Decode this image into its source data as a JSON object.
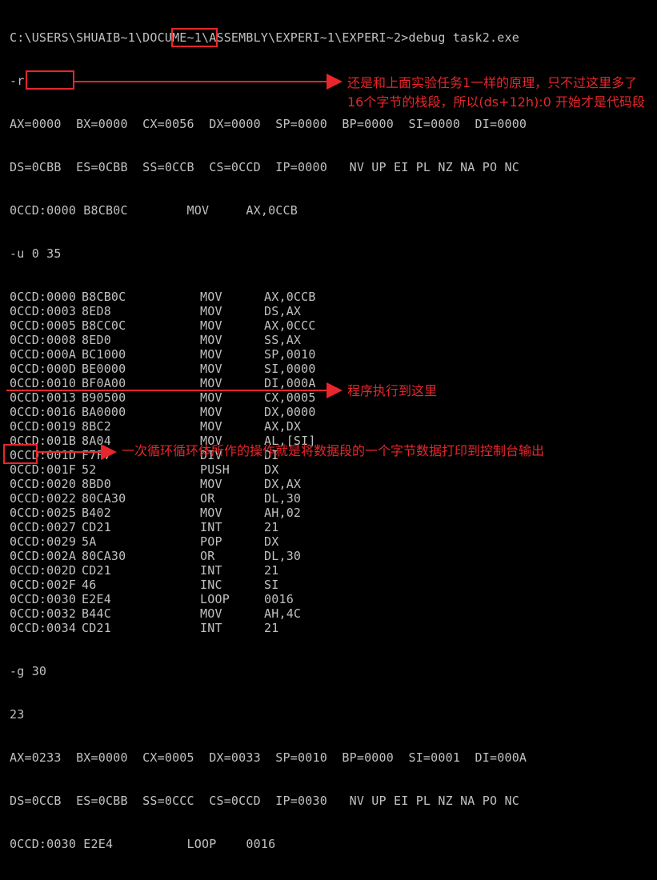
{
  "console": {
    "lines": [
      "C:\\USERS\\SHUAIB~1\\DOCUME~1\\ASSEMBLY\\EXPERI~1\\EXPERI~2>debug task2.exe",
      "-r",
      "AX=0000  BX=0000  CX=0056  DX=0000  SP=0000  BP=0000  SI=0000  DI=0000",
      "DS=0CBB  ES=0CBB  SS=0CCB  CS=0CCD  IP=0000   NV UP EI PL NZ NA PO NC",
      "0CCD:0000 B8CB0C        MOV     AX,0CCB",
      "-u 0 35"
    ],
    "disassembly": [
      {
        "addr": "0CCD:0000",
        "hex": "B8CB0C",
        "mnemonic": "MOV",
        "operands": "AX,0CCB"
      },
      {
        "addr": "0CCD:0003",
        "hex": "8ED8",
        "mnemonic": "MOV",
        "operands": "DS,AX"
      },
      {
        "addr": "0CCD:0005",
        "hex": "B8CC0C",
        "mnemonic": "MOV",
        "operands": "AX,0CCC"
      },
      {
        "addr": "0CCD:0008",
        "hex": "8ED0",
        "mnemonic": "MOV",
        "operands": "SS,AX"
      },
      {
        "addr": "0CCD:000A",
        "hex": "BC1000",
        "mnemonic": "MOV",
        "operands": "SP,0010"
      },
      {
        "addr": "0CCD:000D",
        "hex": "BE0000",
        "mnemonic": "MOV",
        "operands": "SI,0000"
      },
      {
        "addr": "0CCD:0010",
        "hex": "BF0A00",
        "mnemonic": "MOV",
        "operands": "DI,000A"
      },
      {
        "addr": "0CCD:0013",
        "hex": "B90500",
        "mnemonic": "MOV",
        "operands": "CX,0005"
      },
      {
        "addr": "0CCD:0016",
        "hex": "BA0000",
        "mnemonic": "MOV",
        "operands": "DX,0000"
      },
      {
        "addr": "0CCD:0019",
        "hex": "8BC2",
        "mnemonic": "MOV",
        "operands": "AX,DX"
      },
      {
        "addr": "0CCD:001B",
        "hex": "8A04",
        "mnemonic": "MOV",
        "operands": "AL,[SI]"
      },
      {
        "addr": "0CCD:001D",
        "hex": "F7F7",
        "mnemonic": "DIV",
        "operands": "DI"
      },
      {
        "addr": "0CCD:001F",
        "hex": "52",
        "mnemonic": "PUSH",
        "operands": "DX"
      },
      {
        "addr": "0CCD:0020",
        "hex": "8BD0",
        "mnemonic": "MOV",
        "operands": "DX,AX"
      },
      {
        "addr": "0CCD:0022",
        "hex": "80CA30",
        "mnemonic": "OR",
        "operands": "DL,30"
      },
      {
        "addr": "0CCD:0025",
        "hex": "B402",
        "mnemonic": "MOV",
        "operands": "AH,02"
      },
      {
        "addr": "0CCD:0027",
        "hex": "CD21",
        "mnemonic": "INT",
        "operands": "21"
      },
      {
        "addr": "0CCD:0029",
        "hex": "5A",
        "mnemonic": "POP",
        "operands": "DX"
      },
      {
        "addr": "0CCD:002A",
        "hex": "80CA30",
        "mnemonic": "OR",
        "operands": "DL,30"
      },
      {
        "addr": "0CCD:002D",
        "hex": "CD21",
        "mnemonic": "INT",
        "operands": "21"
      },
      {
        "addr": "0CCD:002F",
        "hex": "46",
        "mnemonic": "INC",
        "operands": "SI"
      },
      {
        "addr": "0CCD:0030",
        "hex": "E2E4",
        "mnemonic": "LOOP",
        "operands": "0016"
      },
      {
        "addr": "0CCD:0032",
        "hex": "B44C",
        "mnemonic": "MOV",
        "operands": "AH,4C"
      },
      {
        "addr": "0CCD:0034",
        "hex": "CD21",
        "mnemonic": "INT",
        "operands": "21"
      }
    ],
    "tail_lines": [
      "-g 30",
      "23",
      "AX=0233  BX=0000  CX=0005  DX=0033  SP=0010  BP=0000  SI=0001  DI=000A",
      "DS=0CCB  ES=0CBB  SS=0CCC  CS=0CCD  IP=0030   NV UP EI PL NZ NA PO NC",
      "0CCD:0030 E2E4          LOOP    0016"
    ]
  },
  "annotations": {
    "note1": "还是和上面实验任务1一样的原理，只不过这里多了16个字节的栈段，所以(ds+12h):0 开始才是代码段",
    "note2": "程序执行到这里",
    "note3": "一次循环循环体所作的操作就是将数据段的一个字节数据打印到控制台输出"
  },
  "colors": {
    "background": "#000000",
    "text": "#c0c0c0",
    "annotation": "#e8262b"
  }
}
